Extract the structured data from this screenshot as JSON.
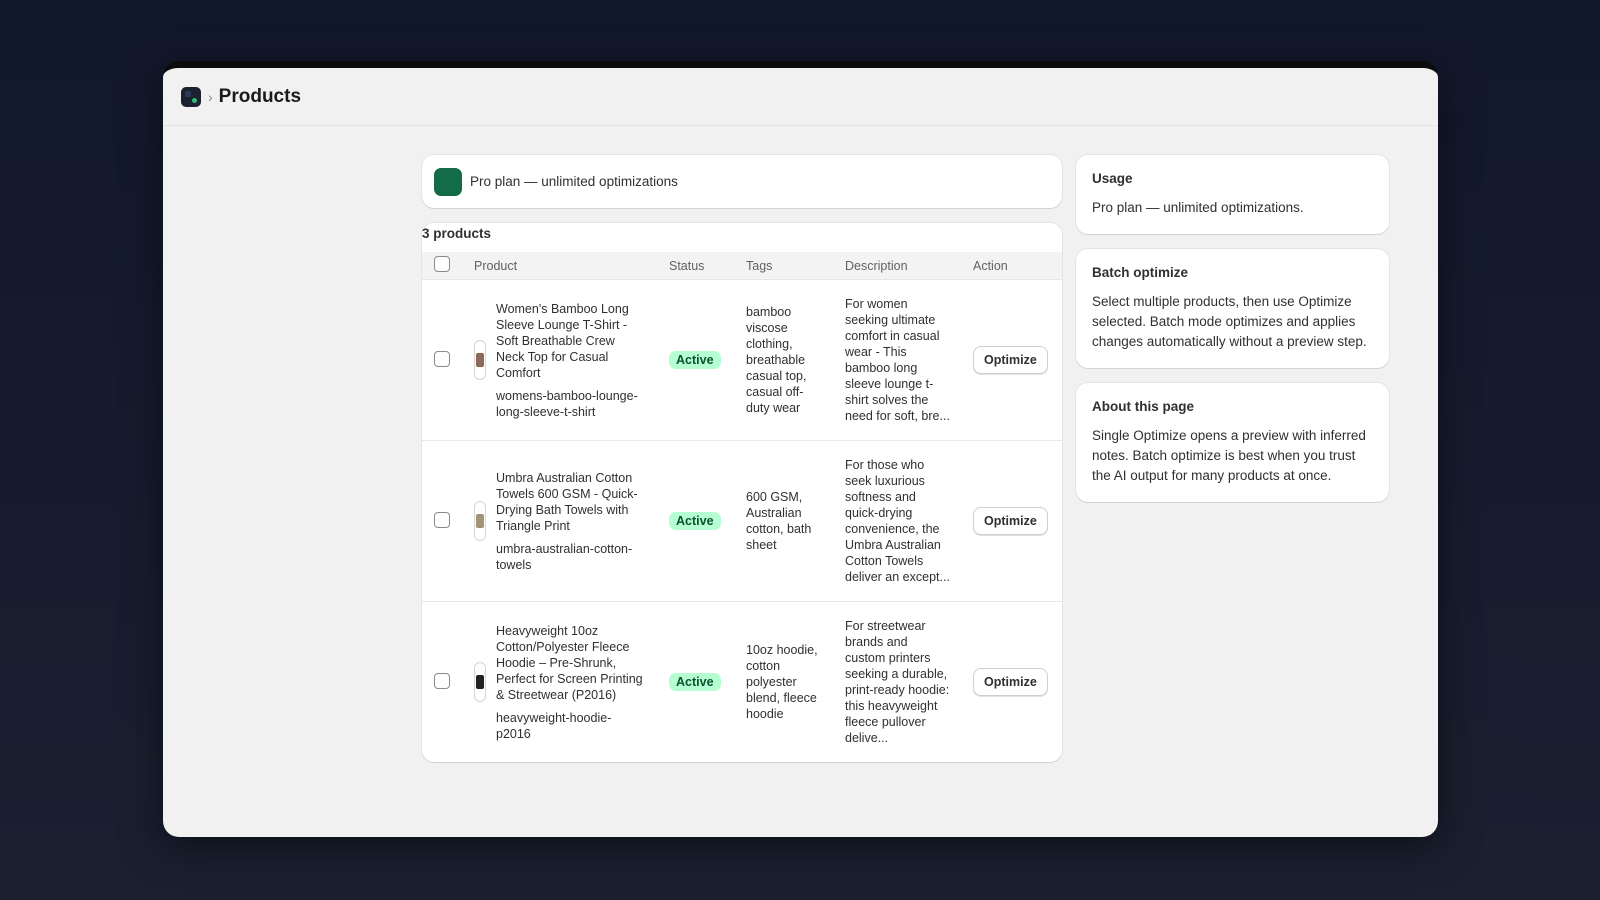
{
  "header": {
    "title": "Products",
    "breadcrumb_separator": "›",
    "app_icon": "app-logo-icon"
  },
  "plan_banner": {
    "text": "Pro plan — unlimited optimizations",
    "badge_color": "#136b48"
  },
  "table": {
    "count_label": "3 products",
    "columns": [
      "Product",
      "Status",
      "Tags",
      "Description",
      "Action"
    ],
    "rows": [
      {
        "title": "Women's Bamboo Long Sleeve Lounge T-Shirt - Soft Breathable Crew Neck Top for Casual Comfort",
        "handle": "womens-bamboo-lounge-long-sleeve-t-shirt",
        "status": "Active",
        "tags": "bamboo viscose clothing, breathable casual top, casual off-duty wear",
        "description": "For women seeking ultimate comfort in casual wear - This bamboo long sleeve lounge t-shirt solves the need for soft, bre...",
        "action": "Optimize"
      },
      {
        "title": "Umbra Australian Cotton Towels 600 GSM - Quick-Drying Bath Towels with Triangle Print",
        "handle": "umbra-australian-cotton-towels",
        "status": "Active",
        "tags": "600 GSM, Australian cotton, bath sheet",
        "description": "For those who seek luxurious softness and quick-drying convenience, the Umbra Australian Cotton Towels deliver an except...",
        "action": "Optimize"
      },
      {
        "title": "Heavyweight 10oz Cotton/Polyester Fleece Hoodie – Pre-Shrunk, Perfect for Screen Printing & Streetwear (P2016)",
        "handle": "heavyweight-hoodie-p2016",
        "status": "Active",
        "tags": "10oz hoodie, cotton polyester blend, fleece hoodie",
        "description": "For streetwear brands and custom printers seeking a durable, print-ready hoodie: this heavyweight fleece pullover delive...",
        "action": "Optimize"
      }
    ]
  },
  "sidebar": {
    "usage": {
      "title": "Usage",
      "body": "Pro plan — unlimited optimizations."
    },
    "batch": {
      "title": "Batch optimize",
      "body": "Select multiple products, then use Optimize selected. Batch mode optimizes and applies changes automatically without a preview step."
    },
    "about": {
      "title": "About this page",
      "body": "Single Optimize opens a preview with inferred notes. Batch optimize is best when you trust the AI output for many products at once."
    }
  },
  "colors": {
    "status_active_bg": "#b4fed2",
    "status_active_text": "#0c5132",
    "background": "#12182b"
  }
}
